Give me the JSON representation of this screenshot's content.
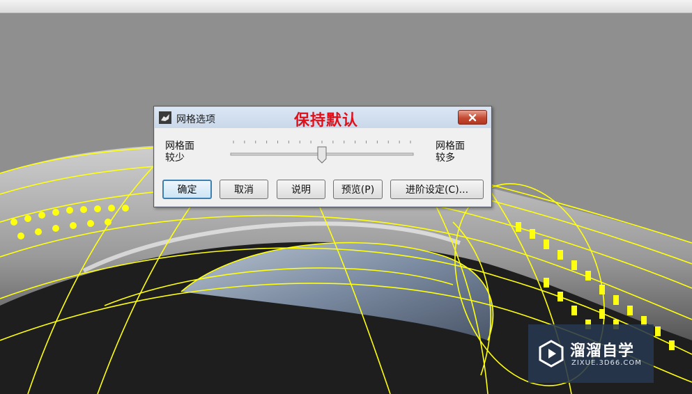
{
  "dialog": {
    "title": "网格选项",
    "annotation": "保持默认",
    "slider": {
      "left_label": "网格面\n较少",
      "right_label": "网格面\n较多",
      "value_fraction": 0.5
    },
    "buttons": {
      "ok": "确定",
      "cancel": "取消",
      "help": "说明",
      "preview": "预览(P)",
      "advanced": "进阶设定(C)..."
    },
    "icons": {
      "app": "rhino-icon",
      "close": "close-icon"
    }
  },
  "watermark": {
    "brand": "溜溜自学",
    "url": "ZIXUE.3D66.COM",
    "icon": "play-icon"
  },
  "colors": {
    "annotation": "#e0101a",
    "wireframe": "#ffff10",
    "viewport_bg": "#8f8f8f",
    "titlebar": "#c9d8ea"
  }
}
